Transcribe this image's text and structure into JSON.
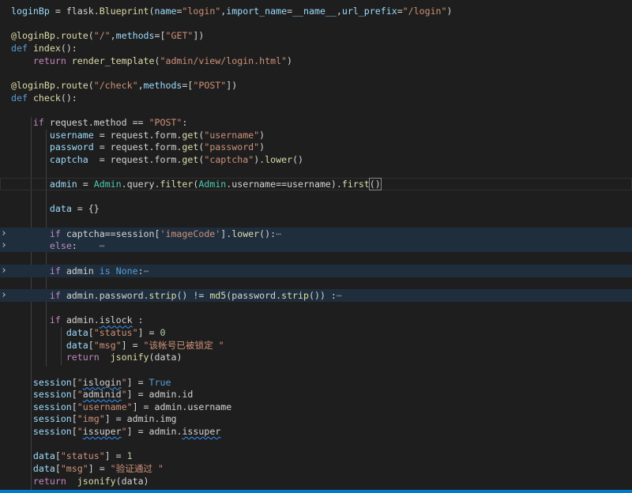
{
  "editor": {
    "language": "python",
    "theme_colors": {
      "background": "#1e1e1e",
      "folded_line_highlight": "#1f2e3d",
      "keyword": "#569cd6",
      "string": "#ce9178",
      "variable": "#9cdcfe",
      "function": "#dcdcaa",
      "number": "#b5cea8",
      "control": "#c586c0",
      "status_bar": "#007acc"
    },
    "lines": [
      {
        "folded": false,
        "tokens": [
          [
            "t-var",
            "loginBp"
          ],
          [
            "t-plain",
            " = flask."
          ],
          [
            "t-fn",
            "Blueprint"
          ],
          [
            "t-plain",
            "("
          ],
          [
            "t-var",
            "name"
          ],
          [
            "t-plain",
            "="
          ],
          [
            "t-str",
            "\"login\""
          ],
          [
            "t-plain",
            ","
          ],
          [
            "t-var",
            "import_name"
          ],
          [
            "t-plain",
            "="
          ],
          [
            "t-var",
            "__name__"
          ],
          [
            "t-plain",
            ","
          ],
          [
            "t-var",
            "url_prefix"
          ],
          [
            "t-plain",
            "="
          ],
          [
            "t-str",
            "\"/login\""
          ],
          [
            "t-plain",
            ")"
          ]
        ]
      },
      {
        "folded": false,
        "tokens": []
      },
      {
        "folded": false,
        "tokens": [
          [
            "t-dec",
            "@loginBp.route"
          ],
          [
            "t-plain",
            "("
          ],
          [
            "t-str",
            "\"/\""
          ],
          [
            "t-plain",
            ","
          ],
          [
            "t-var",
            "methods"
          ],
          [
            "t-plain",
            "=["
          ],
          [
            "t-str",
            "\"GET\""
          ],
          [
            "t-plain",
            "])"
          ]
        ]
      },
      {
        "folded": false,
        "tokens": [
          [
            "t-kw",
            "def"
          ],
          [
            "t-plain",
            " "
          ],
          [
            "t-fn",
            "index"
          ],
          [
            "t-plain",
            "():"
          ]
        ]
      },
      {
        "folded": false,
        "tokens": [
          [
            "t-plain",
            "    "
          ],
          [
            "t-ctl",
            "return"
          ],
          [
            "t-plain",
            " "
          ],
          [
            "t-fn",
            "render_template"
          ],
          [
            "t-plain",
            "("
          ],
          [
            "t-str",
            "\"admin/view/login.html\""
          ],
          [
            "t-plain",
            ")"
          ]
        ]
      },
      {
        "folded": false,
        "tokens": []
      },
      {
        "folded": false,
        "tokens": [
          [
            "t-dec",
            "@loginBp.route"
          ],
          [
            "t-plain",
            "("
          ],
          [
            "t-str",
            "\"/check\""
          ],
          [
            "t-plain",
            ","
          ],
          [
            "t-var",
            "methods"
          ],
          [
            "t-plain",
            "=["
          ],
          [
            "t-str",
            "\"POST\""
          ],
          [
            "t-plain",
            "])"
          ]
        ]
      },
      {
        "folded": false,
        "tokens": [
          [
            "t-kw",
            "def"
          ],
          [
            "t-plain",
            " "
          ],
          [
            "t-fn",
            "check"
          ],
          [
            "t-plain",
            "():"
          ]
        ]
      },
      {
        "folded": false,
        "tokens": []
      },
      {
        "folded": false,
        "tokens": [
          [
            "t-plain",
            "    "
          ],
          [
            "t-ctl",
            "if"
          ],
          [
            "t-plain",
            " request.method == "
          ],
          [
            "t-str",
            "\"POST\""
          ],
          [
            "t-plain",
            ":"
          ]
        ]
      },
      {
        "folded": false,
        "tokens": [
          [
            "t-plain",
            "       "
          ],
          [
            "t-var",
            "username"
          ],
          [
            "t-plain",
            " = request.form."
          ],
          [
            "t-fn",
            "get"
          ],
          [
            "t-plain",
            "("
          ],
          [
            "t-str",
            "\"username\""
          ],
          [
            "t-plain",
            ")"
          ]
        ]
      },
      {
        "folded": false,
        "tokens": [
          [
            "t-plain",
            "       "
          ],
          [
            "t-var",
            "password"
          ],
          [
            "t-plain",
            " = request.form."
          ],
          [
            "t-fn",
            "get"
          ],
          [
            "t-plain",
            "("
          ],
          [
            "t-str",
            "\"password\""
          ],
          [
            "t-plain",
            ")"
          ]
        ]
      },
      {
        "folded": false,
        "tokens": [
          [
            "t-plain",
            "       "
          ],
          [
            "t-var",
            "captcha"
          ],
          [
            "t-plain",
            "  = request.form."
          ],
          [
            "t-fn",
            "get"
          ],
          [
            "t-plain",
            "("
          ],
          [
            "t-str",
            "\"captcha\""
          ],
          [
            "t-plain",
            ")."
          ],
          [
            "t-fn",
            "lower"
          ],
          [
            "t-plain",
            "()"
          ]
        ]
      },
      {
        "folded": false,
        "tokens": []
      },
      {
        "folded": false,
        "current": true,
        "tokens": [
          [
            "t-plain",
            "       "
          ],
          [
            "t-var",
            "admin"
          ],
          [
            "t-plain",
            " = "
          ],
          [
            "t-cls",
            "Admin"
          ],
          [
            "t-plain",
            ".query."
          ],
          [
            "t-fn",
            "filter"
          ],
          [
            "t-plain",
            "("
          ],
          [
            "t-cls",
            "Admin"
          ],
          [
            "t-plain",
            ".username==username)."
          ],
          [
            "t-fn",
            "first"
          ],
          [
            "t-bracket",
            "()"
          ]
        ]
      },
      {
        "folded": false,
        "tokens": []
      },
      {
        "folded": false,
        "tokens": [
          [
            "t-plain",
            "       "
          ],
          [
            "t-var",
            "data"
          ],
          [
            "t-plain",
            " = {}"
          ]
        ]
      },
      {
        "folded": false,
        "tokens": []
      },
      {
        "folded": true,
        "tokens": [
          [
            "t-plain",
            "       "
          ],
          [
            "t-ctl",
            "if"
          ],
          [
            "t-plain",
            " captcha==session["
          ],
          [
            "t-str",
            "'imageCode'"
          ],
          [
            "t-plain",
            "]."
          ],
          [
            "t-fn",
            "lower"
          ],
          [
            "t-plain",
            "():"
          ],
          [
            "t-ell",
            "⋯"
          ]
        ]
      },
      {
        "folded": true,
        "tokens": [
          [
            "t-plain",
            "       "
          ],
          [
            "t-ctl",
            "else"
          ],
          [
            "t-plain",
            ":    "
          ],
          [
            "t-ell",
            "⋯"
          ]
        ]
      },
      {
        "folded": false,
        "tokens": []
      },
      {
        "folded": true,
        "tokens": [
          [
            "t-plain",
            "       "
          ],
          [
            "t-ctl",
            "if"
          ],
          [
            "t-plain",
            " admin "
          ],
          [
            "t-kw",
            "is"
          ],
          [
            "t-plain",
            " "
          ],
          [
            "t-kw",
            "None"
          ],
          [
            "t-plain",
            ":"
          ],
          [
            "t-ell",
            "⋯"
          ]
        ]
      },
      {
        "folded": false,
        "tokens": []
      },
      {
        "folded": true,
        "tokens": [
          [
            "t-plain",
            "       "
          ],
          [
            "t-ctl",
            "if"
          ],
          [
            "t-plain",
            " admin.password."
          ],
          [
            "t-fn",
            "strip"
          ],
          [
            "t-plain",
            "() != "
          ],
          [
            "t-fn",
            "md5"
          ],
          [
            "t-plain",
            "(password."
          ],
          [
            "t-fn",
            "strip"
          ],
          [
            "t-plain",
            "()) :"
          ],
          [
            "t-ell",
            "⋯"
          ]
        ]
      },
      {
        "folded": false,
        "tokens": []
      },
      {
        "folded": false,
        "tokens": [
          [
            "t-plain",
            "       "
          ],
          [
            "t-ctl",
            "if"
          ],
          [
            "t-plain",
            " admin."
          ],
          [
            "t-squig",
            "islock"
          ],
          [
            "t-plain",
            " :"
          ]
        ]
      },
      {
        "folded": false,
        "tokens": [
          [
            "t-plain",
            "          "
          ],
          [
            "t-var",
            "data"
          ],
          [
            "t-plain",
            "["
          ],
          [
            "t-str",
            "\"status\""
          ],
          [
            "t-plain",
            "] = "
          ],
          [
            "t-num",
            "0"
          ]
        ]
      },
      {
        "folded": false,
        "tokens": [
          [
            "t-plain",
            "          "
          ],
          [
            "t-var",
            "data"
          ],
          [
            "t-plain",
            "["
          ],
          [
            "t-str",
            "\"msg\""
          ],
          [
            "t-plain",
            "] = "
          ],
          [
            "t-str",
            "\"该帐号已被锁定 \""
          ]
        ]
      },
      {
        "folded": false,
        "tokens": [
          [
            "t-plain",
            "          "
          ],
          [
            "t-ctl",
            "return"
          ],
          [
            "t-plain",
            "  "
          ],
          [
            "t-fn",
            "jsonify"
          ],
          [
            "t-plain",
            "(data)"
          ]
        ]
      },
      {
        "folded": false,
        "tokens": []
      },
      {
        "folded": false,
        "tokens": [
          [
            "t-plain",
            "    "
          ],
          [
            "t-var",
            "session"
          ],
          [
            "t-plain",
            "["
          ],
          [
            "t-str",
            "\""
          ],
          [
            "t-squig",
            "islogin"
          ],
          [
            "t-str",
            "\""
          ],
          [
            "t-plain",
            "] = "
          ],
          [
            "t-kw",
            "True"
          ]
        ]
      },
      {
        "folded": false,
        "tokens": [
          [
            "t-plain",
            "    "
          ],
          [
            "t-var",
            "session"
          ],
          [
            "t-plain",
            "["
          ],
          [
            "t-str",
            "\""
          ],
          [
            "t-squig",
            "adminid"
          ],
          [
            "t-str",
            "\""
          ],
          [
            "t-plain",
            "] = admin.id"
          ]
        ]
      },
      {
        "folded": false,
        "tokens": [
          [
            "t-plain",
            "    "
          ],
          [
            "t-var",
            "session"
          ],
          [
            "t-plain",
            "["
          ],
          [
            "t-str",
            "\"username\""
          ],
          [
            "t-plain",
            "] = admin.username"
          ]
        ]
      },
      {
        "folded": false,
        "tokens": [
          [
            "t-plain",
            "    "
          ],
          [
            "t-var",
            "session"
          ],
          [
            "t-plain",
            "["
          ],
          [
            "t-str",
            "\"img\""
          ],
          [
            "t-plain",
            "] = admin.img"
          ]
        ]
      },
      {
        "folded": false,
        "tokens": [
          [
            "t-plain",
            "    "
          ],
          [
            "t-var",
            "session"
          ],
          [
            "t-plain",
            "["
          ],
          [
            "t-str",
            "\""
          ],
          [
            "t-squig",
            "issuper"
          ],
          [
            "t-str",
            "\""
          ],
          [
            "t-plain",
            "] = admin."
          ],
          [
            "t-squig",
            "issuper"
          ]
        ]
      },
      {
        "folded": false,
        "tokens": []
      },
      {
        "folded": false,
        "tokens": [
          [
            "t-plain",
            "    "
          ],
          [
            "t-var",
            "data"
          ],
          [
            "t-plain",
            "["
          ],
          [
            "t-str",
            "\"status\""
          ],
          [
            "t-plain",
            "] = "
          ],
          [
            "t-num",
            "1"
          ]
        ]
      },
      {
        "folded": false,
        "tokens": [
          [
            "t-plain",
            "    "
          ],
          [
            "t-var",
            "data"
          ],
          [
            "t-plain",
            "["
          ],
          [
            "t-str",
            "\"msg\""
          ],
          [
            "t-plain",
            "] = "
          ],
          [
            "t-str",
            "\"验证通过 \""
          ]
        ]
      },
      {
        "folded": false,
        "tokens": [
          [
            "t-plain",
            "    "
          ],
          [
            "t-ctl",
            "return"
          ],
          [
            "t-plain",
            "  "
          ],
          [
            "t-fn",
            "jsonify"
          ],
          [
            "t-plain",
            "(data)"
          ]
        ]
      }
    ]
  }
}
